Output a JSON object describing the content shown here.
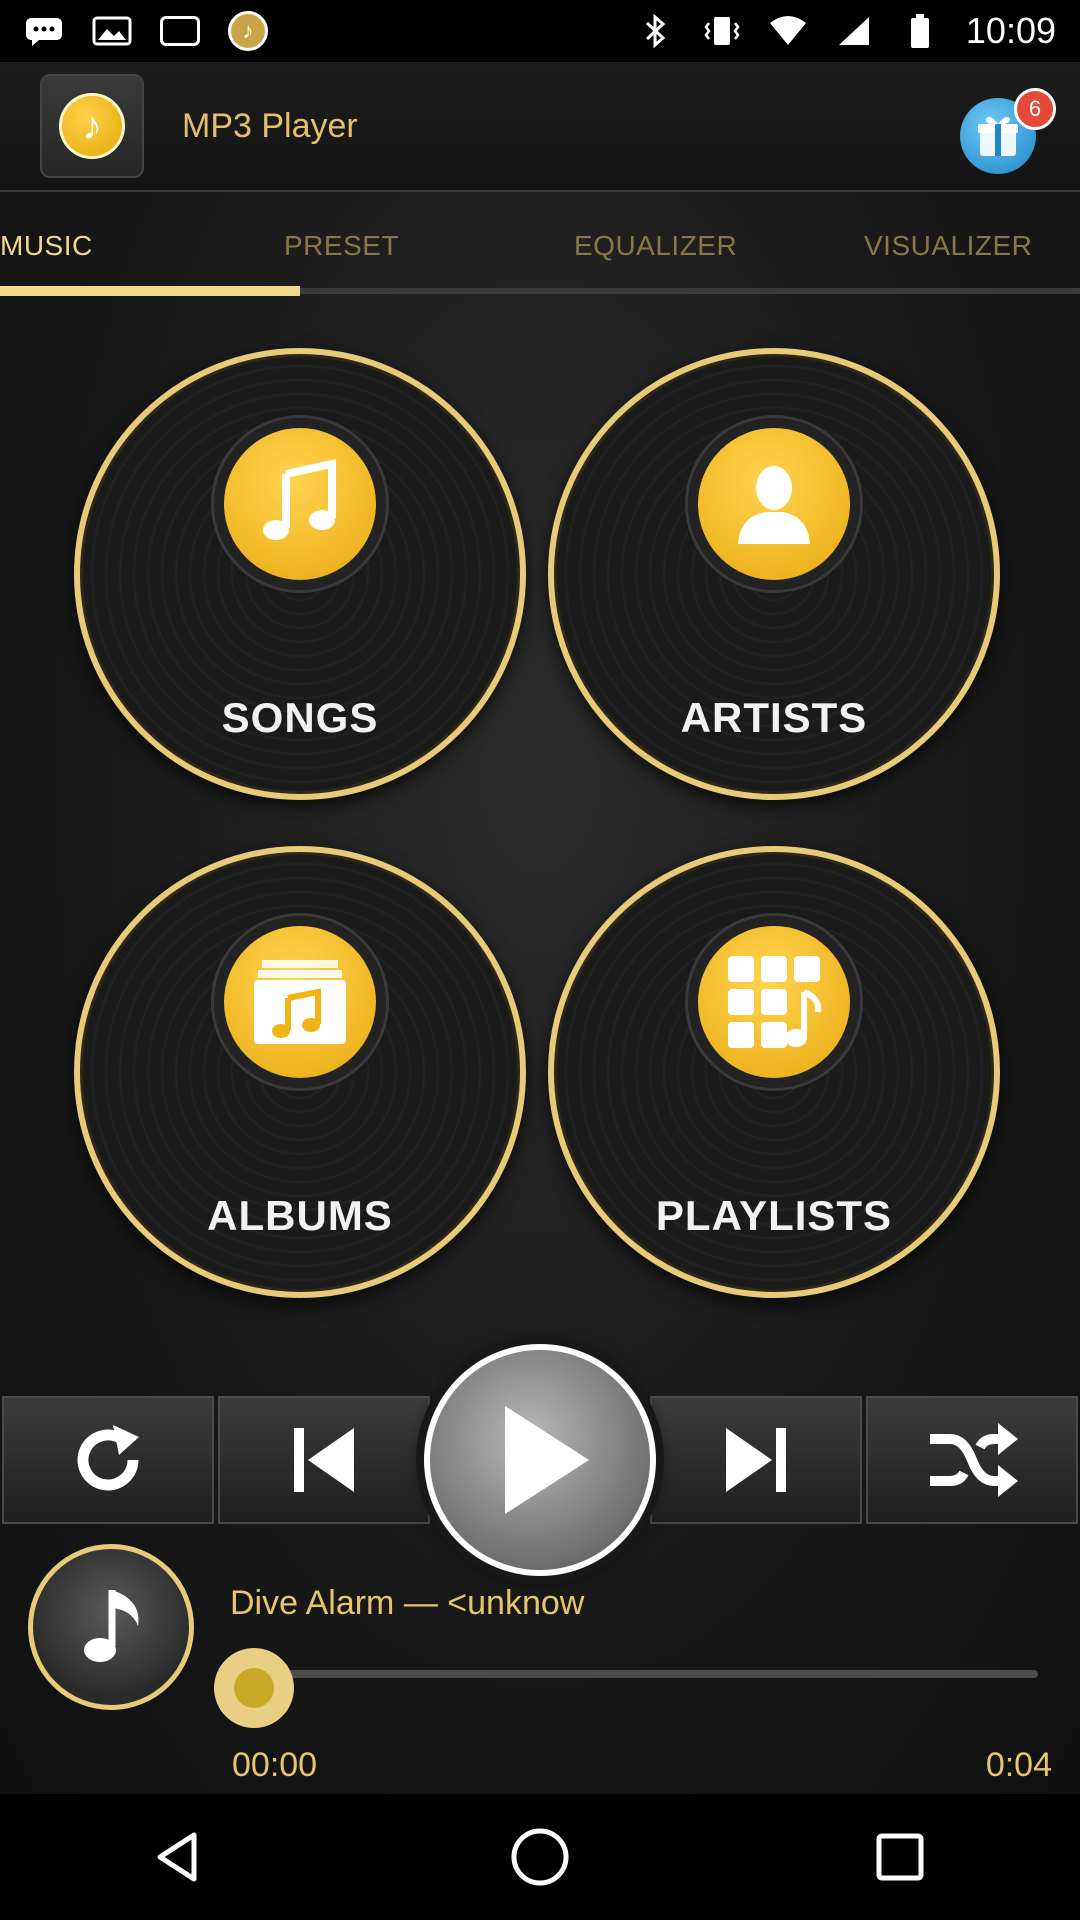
{
  "status_bar": {
    "time": "10:09",
    "icons": [
      "messages-icon",
      "photo-icon",
      "box-icon",
      "app-notification-icon",
      "bluetooth-icon",
      "vibrate-icon",
      "wifi-icon",
      "signal-icon",
      "battery-icon"
    ]
  },
  "header": {
    "title": "MP3 Player",
    "gift_badge": "6"
  },
  "tabs": [
    {
      "label": "MUSIC",
      "active": true
    },
    {
      "label": "PRESET",
      "active": false
    },
    {
      "label": "EQUALIZER",
      "active": false
    },
    {
      "label": "VISUALIZER",
      "active": false
    }
  ],
  "categories": [
    {
      "label": "SONGS",
      "icon": "music-note-icon"
    },
    {
      "label": "ARTISTS",
      "icon": "person-icon"
    },
    {
      "label": "ALBUMS",
      "icon": "album-icon"
    },
    {
      "label": "PLAYLISTS",
      "icon": "playlist-grid-icon"
    }
  ],
  "controls": [
    "repeat-icon",
    "previous-icon",
    "play-icon",
    "next-icon",
    "shuffle-icon"
  ],
  "now_playing": {
    "title": "Dive Alarm — <unknow",
    "elapsed": "00:00",
    "duration": "0:04",
    "progress": 0
  },
  "colors": {
    "accent": "#e7cb78",
    "disc_center": "#f3bd1f"
  }
}
